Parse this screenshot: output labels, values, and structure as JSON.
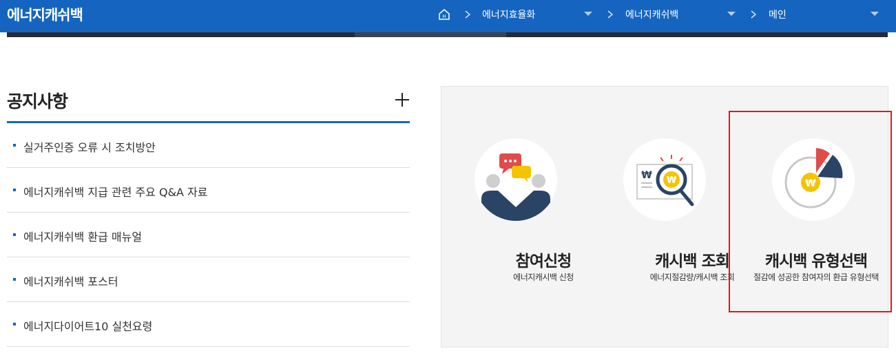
{
  "header": {
    "logo": "에너지캐쉬백",
    "breadcrumb": [
      {
        "label": "에너지효율화"
      },
      {
        "label": "에너지캐쉬백"
      },
      {
        "label": "메인"
      }
    ]
  },
  "notice": {
    "title": "공지사항",
    "items": [
      {
        "label": "실거주인증 오류 시 조치방안"
      },
      {
        "label": "에너지캐쉬백 지급 관련 주요 Q&A 자료"
      },
      {
        "label": "에너지캐쉬백 환급 매뉴얼"
      },
      {
        "label": "에너지캐쉬백 포스터"
      },
      {
        "label": "에너지다이어트10 실천요령"
      }
    ]
  },
  "services": [
    {
      "title": "참여신청",
      "desc": "에너지캐시백 신청",
      "icon": "chat-people-icon"
    },
    {
      "title": "캐시백 조회",
      "desc": "에너지절감량/캐시백 조회",
      "icon": "won-magnifier-icon"
    },
    {
      "title": "캐시백 유형선택",
      "desc": "절감에 성공한 참여자의 환급 유형선택",
      "icon": "won-pie-chart-icon"
    }
  ],
  "colors": {
    "brand_blue": "#1565c0",
    "navy": "#2a4466",
    "red_accent": "#e04b4b",
    "coin_yellow": "#f5c400",
    "highlight_red": "#e0161b"
  }
}
